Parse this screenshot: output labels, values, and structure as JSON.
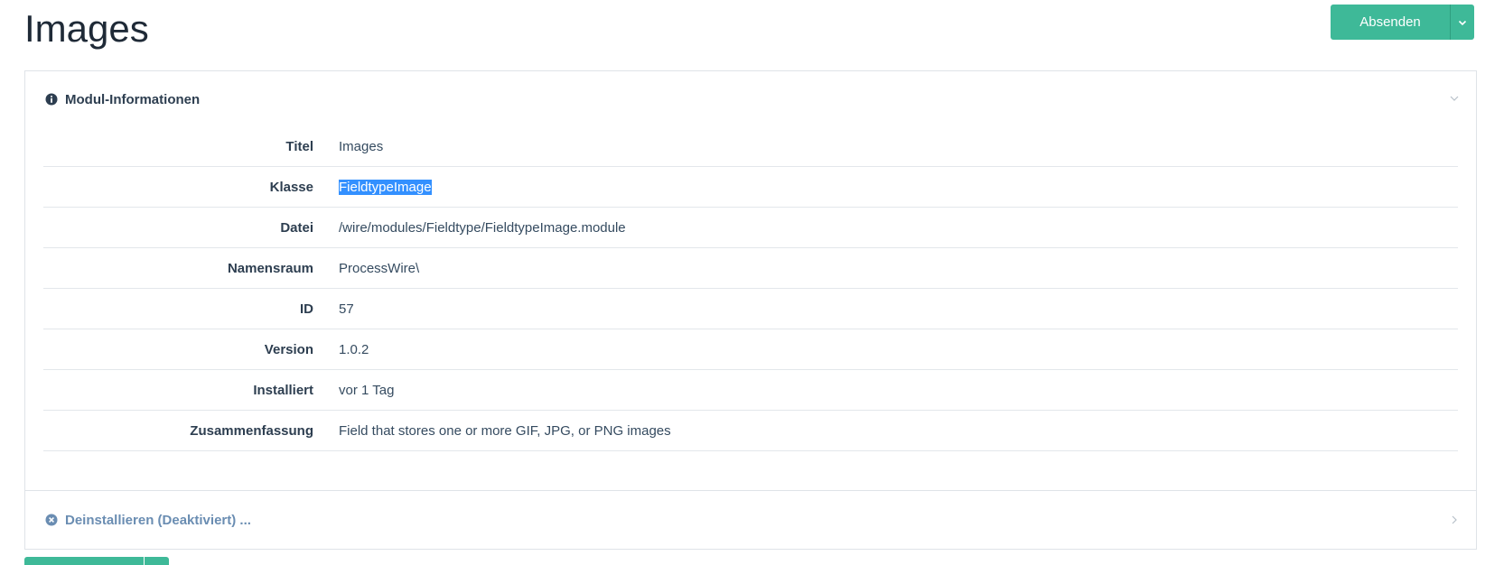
{
  "page": {
    "title": "Images"
  },
  "actions": {
    "submit_label": "Absenden"
  },
  "module_info": {
    "header": "Modul-Informationen",
    "rows": [
      {
        "key": "Titel",
        "value": "Images"
      },
      {
        "key": "Klasse",
        "value": "FieldtypeImage",
        "selected": true
      },
      {
        "key": "Datei",
        "value": "/wire/modules/Fieldtype/FieldtypeImage.module"
      },
      {
        "key": "Namensraum",
        "value": "ProcessWire\\"
      },
      {
        "key": "ID",
        "value": "57"
      },
      {
        "key": "Version",
        "value": "1.0.2"
      },
      {
        "key": "Installiert",
        "value": "vor 1 Tag"
      },
      {
        "key": "Zusammenfassung",
        "value": "Field that stores one or more GIF, JPG, or PNG images"
      }
    ]
  },
  "uninstall": {
    "header": "Deinstallieren (Deaktiviert) ..."
  },
  "colors": {
    "accent": "#3eb998",
    "heading": "#2d3e50",
    "muted_link": "#6a8db2",
    "selection": "#3390ff"
  },
  "icons": {
    "info": "info-circle-icon",
    "uninstall": "times-circle-icon",
    "collapse": "chevron-down-icon",
    "expand": "chevron-right-icon",
    "dropdown": "chevron-down-icon"
  }
}
